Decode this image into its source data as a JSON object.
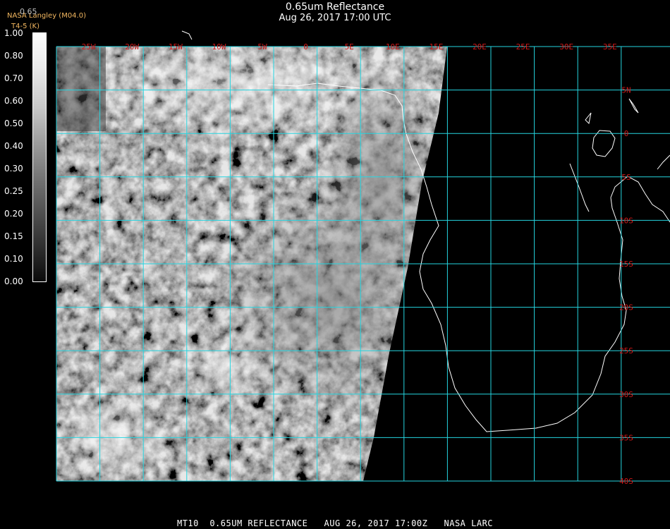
{
  "header": {
    "title": "0.65um Reflectance",
    "datetime": "Aug 26, 2017 17:00 UTC"
  },
  "credit": {
    "line1": "NASA Langley (M04.0)",
    "line2": "T4-5 (K)"
  },
  "colorbar": {
    "top_label": "0.65",
    "ticks": [
      "1.00",
      "0.80",
      "0.70",
      "0.60",
      "0.50",
      "0.40",
      "0.30",
      "0.25",
      "0.20",
      "0.15",
      "0.10",
      "0.00"
    ]
  },
  "map": {
    "longitude_labels": [
      "25W",
      "20W",
      "15W",
      "10W",
      "5W",
      "0",
      "5E",
      "10E",
      "15E",
      "20E",
      "25E",
      "30E",
      "35E"
    ],
    "latitude_labels": [
      "5N",
      "0",
      "5S",
      "10S",
      "15S",
      "20S",
      "25S",
      "30S",
      "35S",
      "40S"
    ],
    "grid_color": "#25d5e0",
    "label_color": "#d01818",
    "coastline_color": "#ffffff"
  },
  "footer": {
    "text": "MT10  0.65UM REFLECTANCE   AUG 26, 2017 17:00Z   NASA LARC"
  }
}
